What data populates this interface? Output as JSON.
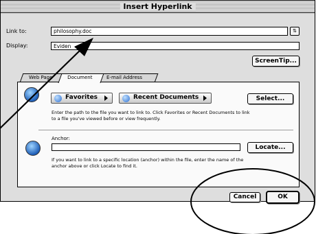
{
  "window": {
    "title": "Insert Hyperlink"
  },
  "form": {
    "link_to_label": "Link to:",
    "link_to_value": "philosophy.doc",
    "display_label": "Display:",
    "display_value": "Eviden",
    "screentip_label": "ScreenTip..."
  },
  "tabs": [
    {
      "label": "Web Page"
    },
    {
      "label": "Document"
    },
    {
      "label": "E-mail Address"
    }
  ],
  "document": {
    "favorites_label": "Favorites",
    "recent_label": "Recent Documents",
    "select_label": "Select...",
    "path_help": "Enter the path to the file you want to link to. Click Favorites or Recent Documents to link to a file you've viewed before or view frequently.",
    "anchor_label": "Anchor:",
    "anchor_value": "",
    "locate_label": "Locate...",
    "anchor_help": "If you want to link to a specific location (anchor) within the file, enter the name of the anchor above or click Locate to find it."
  },
  "footer": {
    "cancel_label": "Cancel",
    "ok_label": "OK"
  },
  "colors": {
    "window_bg": "#dedede",
    "panel_bg": "#fafafa",
    "annotation": "#000000"
  }
}
